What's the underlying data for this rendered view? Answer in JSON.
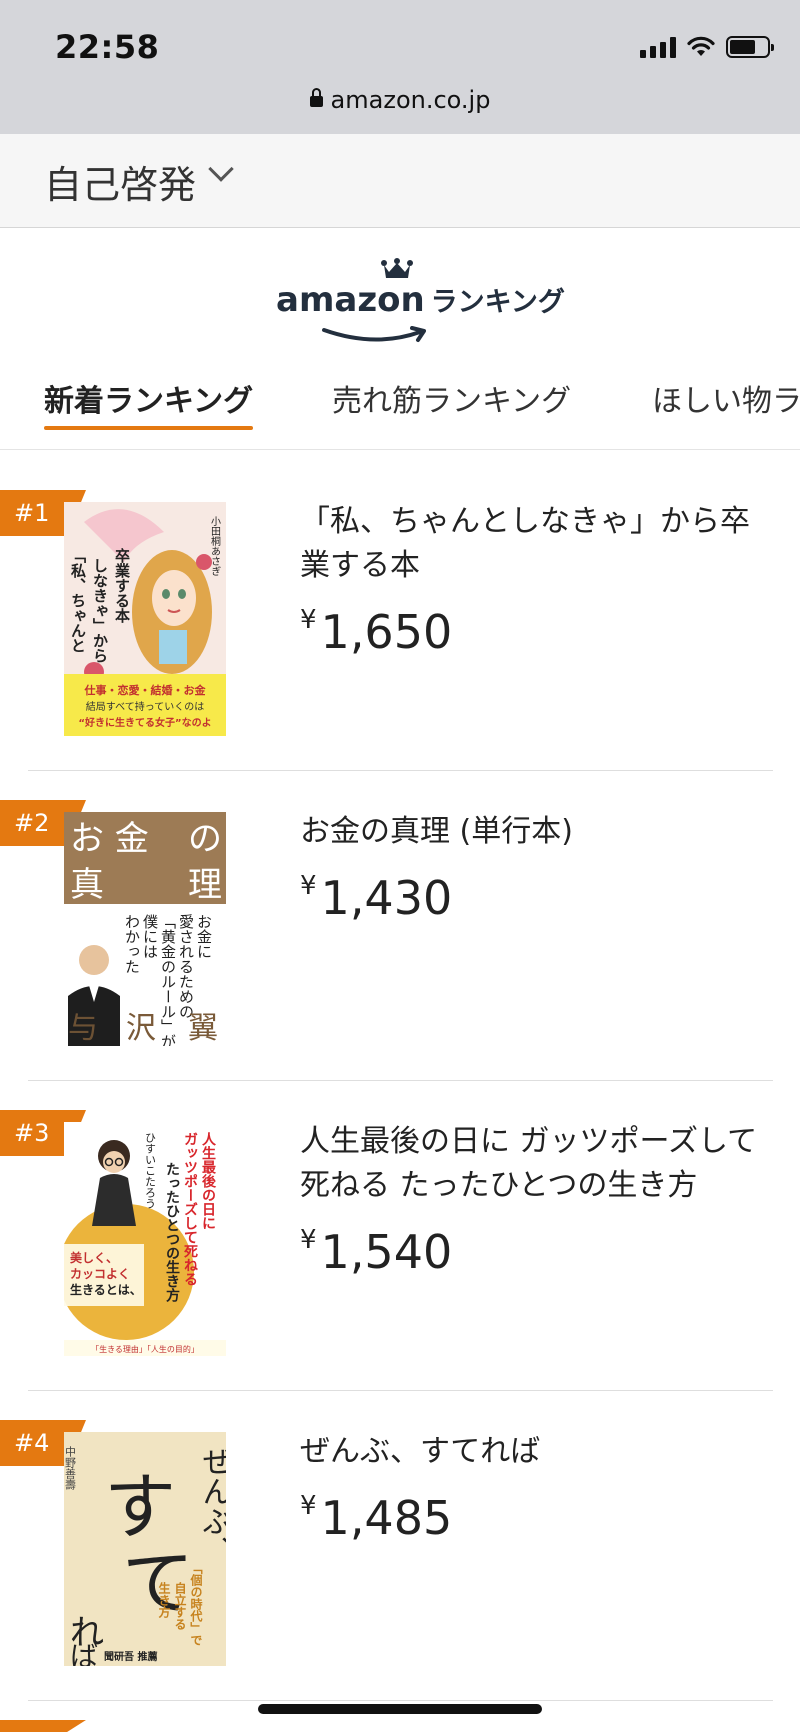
{
  "status_bar": {
    "time": "22:58"
  },
  "browser": {
    "url": "amazon.co.jp"
  },
  "category": {
    "label": "自己啓発"
  },
  "logo": {
    "brand": "amazon",
    "subtitle": "ランキング"
  },
  "tabs": [
    {
      "label": "新着ランキング",
      "active": true
    },
    {
      "label": "売れ筋ランキング",
      "active": false
    },
    {
      "label": "ほしい物ランキング",
      "active": false
    }
  ],
  "products": [
    {
      "rank": "#1",
      "title": "「私、ちゃんとしなきゃ」から卒業する本",
      "currency": "¥",
      "price": "1,650",
      "cover": {
        "title": "「私、ちゃんとしなきゃ」から卒業する本",
        "author": "小田桐あさぎ",
        "band": "仕事・恋愛・結婚・お金 結局すべて持っていくのは “好きに生きてる女子”なのよ",
        "bg": "#f7e9e3",
        "accent": "#f7e94a"
      }
    },
    {
      "rank": "#2",
      "title": "お金の真理 (単行本)",
      "currency": "¥",
      "price": "1,430",
      "cover": {
        "top_left": "お 金",
        "top_right": "の",
        "mid_left": "真",
        "mid_right": "理",
        "vertical": "お金に愛されるための「黄金のルール」が僕にはわかった",
        "author": "与 沢 翼",
        "bg": "#9d7b55"
      }
    },
    {
      "rank": "#3",
      "title": "人生最後の日に ガッツポーズして死ねる たったひとつの生き方",
      "currency": "¥",
      "price": "1,540",
      "cover": {
        "vertical": "人生最後の日にガッツポーズして死ねるたったひとつの生き方",
        "author": "ひすいこたろう",
        "band": "美しく、カッコよく生きるとは、こういうことだ!",
        "bg": "#ffffff",
        "accent": "#e8a71a"
      }
    },
    {
      "rank": "#4",
      "title": "ぜんぶ、すてれば",
      "currency": "¥",
      "price": "1,485",
      "cover": {
        "big": "す て",
        "small": "ぜんぶ、",
        "end": "れば",
        "author": "中野善壽",
        "bg": "#f1e4c2",
        "accent": "#c7831f"
      }
    }
  ]
}
